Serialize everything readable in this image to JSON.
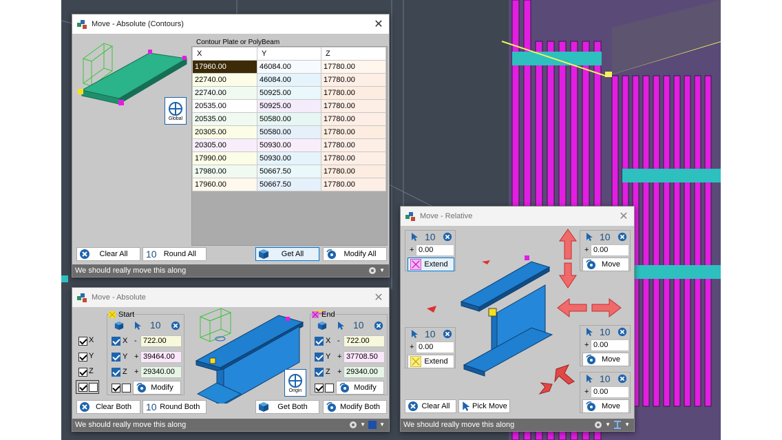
{
  "colors": {
    "accent": "#1e64ad",
    "magenta": "#e21ee2",
    "cyan": "#2ebfbf",
    "statusbar": "#6c6c6c",
    "selected_cell": "#3d2b08"
  },
  "status_text": "We should really move this along",
  "win_contours": {
    "title": "Move - Absolute (Contours)",
    "group_label": "Contour Plate or PolyBeam",
    "columns": [
      "X",
      "Y",
      "Z"
    ],
    "rows": [
      [
        "17960.00",
        "46084.00",
        "17780.00"
      ],
      [
        "22740.00",
        "46084.00",
        "17780.00"
      ],
      [
        "22740.00",
        "50925.00",
        "17780.00"
      ],
      [
        "20535.00",
        "50925.00",
        "17780.00"
      ],
      [
        "20535.00",
        "50580.00",
        "17780.00"
      ],
      [
        "20305.00",
        "50580.00",
        "17780.00"
      ],
      [
        "20305.00",
        "50930.00",
        "17780.00"
      ],
      [
        "17990.00",
        "50930.00",
        "17780.00"
      ],
      [
        "17980.00",
        "50667.50",
        "17780.00"
      ],
      [
        "17960.00",
        "50667.50",
        "17780.00"
      ]
    ],
    "global_label": "Global",
    "clear_all": "Clear All",
    "round_num": "10",
    "round_all": "Round All",
    "get_all": "Get All",
    "modify_all": "Modify All"
  },
  "win_absolute": {
    "title": "Move - Absolute",
    "axes": [
      "X",
      "Y",
      "Z"
    ],
    "start": {
      "label": "Start",
      "num": "10",
      "x_sign": "-",
      "x": "722.00",
      "y_sign": "+",
      "y": "39464.00",
      "z_sign": "+",
      "z": "29340.00",
      "modify": "Modify"
    },
    "end": {
      "label": "End",
      "num": "10",
      "x_sign": "-",
      "x": "722.00",
      "y_sign": "+",
      "y": "37708.50",
      "z_sign": "+",
      "z": "29340.00",
      "modify": "Modify"
    },
    "origin_label": "Origin",
    "clear_both": "Clear Both",
    "round_num": "10",
    "round_both": "Round Both",
    "get_both": "Get Both",
    "modify_both": "Modify Both"
  },
  "win_relative": {
    "title": "Move - Relative",
    "tl": {
      "num": "10",
      "sign": "+",
      "value": "0.00",
      "button": "Extend"
    },
    "bl": {
      "num": "10",
      "sign": "+",
      "value": "0.00",
      "button": "Extend"
    },
    "tr": {
      "num": "10",
      "sign": "+",
      "value": "0.00",
      "button": "Move"
    },
    "mr": {
      "num": "10",
      "sign": "+",
      "value": "0.00",
      "button": "Move"
    },
    "br": {
      "num": "10",
      "sign": "+",
      "value": "0.00",
      "button": "Move"
    },
    "clear_all": "Clear All",
    "pick_move": "Pick Move"
  }
}
